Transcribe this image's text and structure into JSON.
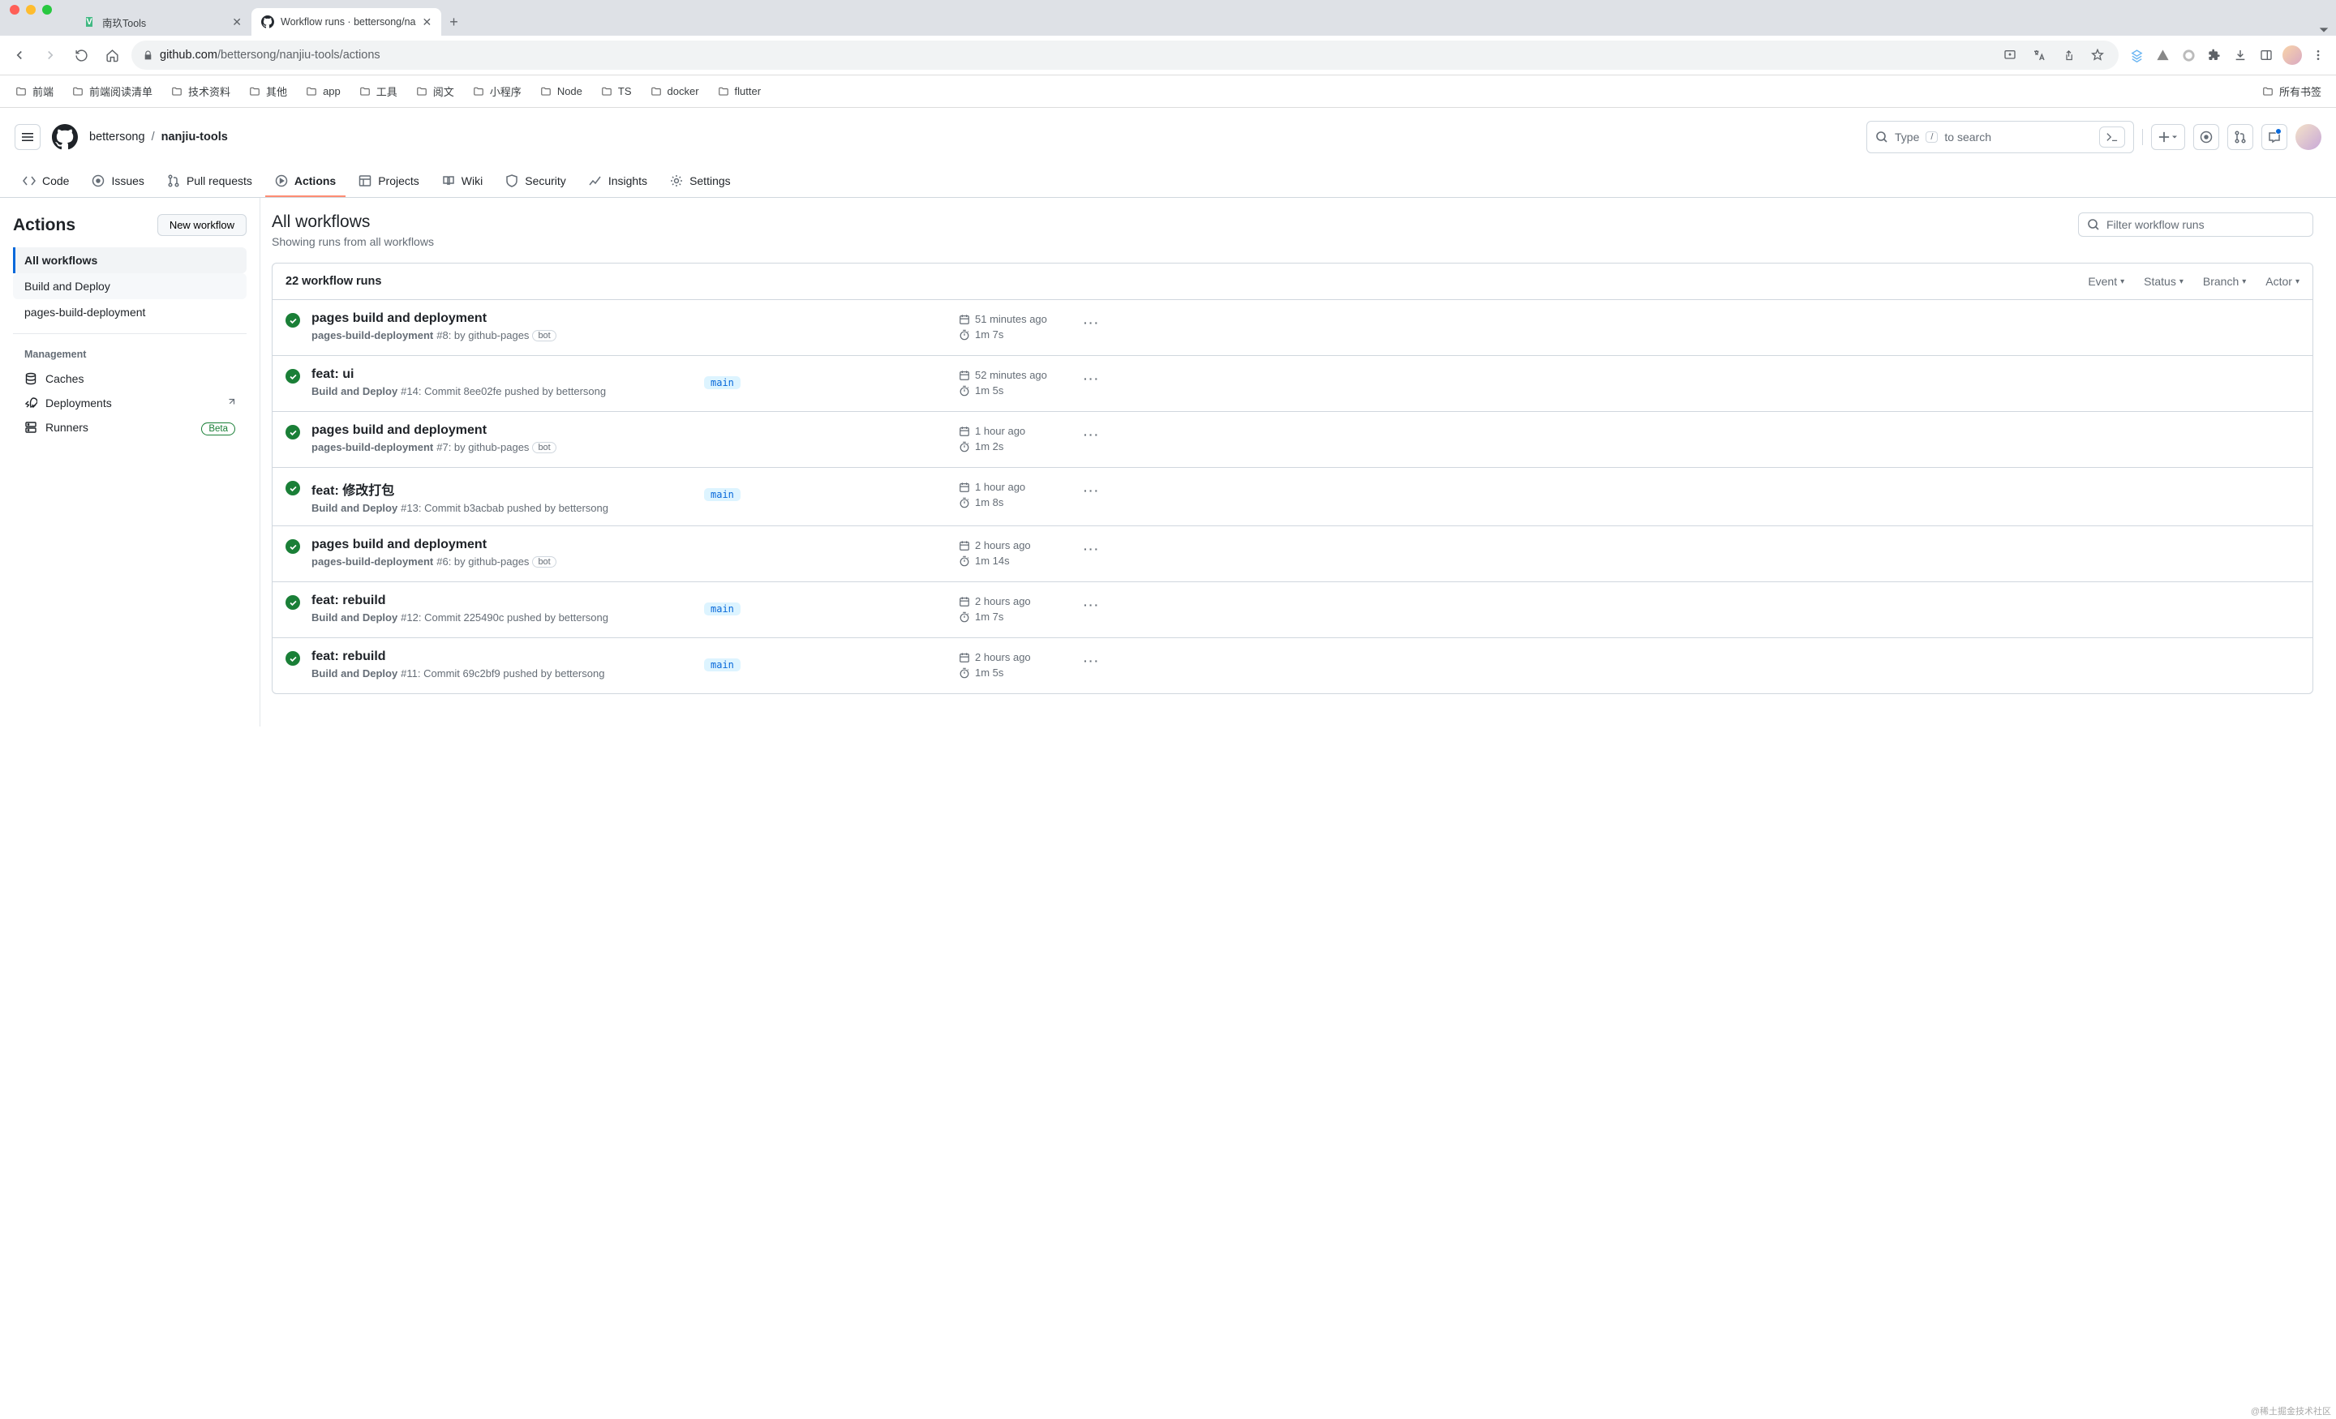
{
  "browser": {
    "tabs": [
      {
        "title": "南玖Tools",
        "favicon_bg": "#41b883",
        "favicon_char": "V",
        "active": false
      },
      {
        "title": "Workflow runs · bettersong/na",
        "favicon_bg": "#24292f",
        "favicon_char": "",
        "active": true
      }
    ],
    "url_host": "github.com",
    "url_path": "/bettersong/nanjiu-tools/actions",
    "bookmarks": [
      "前端",
      "前端阅读清单",
      "技术资料",
      "其他",
      "app",
      "工具",
      "阅文",
      "小程序",
      "Node",
      "TS",
      "docker",
      "flutter"
    ],
    "all_bookmarks": "所有书签"
  },
  "github": {
    "owner": "bettersong",
    "repo": "nanjiu-tools",
    "search_pre": "Type",
    "search_key": "/",
    "search_post": "to search",
    "nav": [
      "Code",
      "Issues",
      "Pull requests",
      "Actions",
      "Projects",
      "Wiki",
      "Security",
      "Insights",
      "Settings"
    ],
    "nav_active": "Actions"
  },
  "sidebar": {
    "title": "Actions",
    "new_workflow": "New workflow",
    "workflows": [
      {
        "label": "All workflows",
        "active": true
      },
      {
        "label": "Build and Deploy",
        "hover": true
      },
      {
        "label": "pages-build-deployment"
      }
    ],
    "mgmt_heading": "Management",
    "mgmt": [
      {
        "label": "Caches",
        "icon": "database"
      },
      {
        "label": "Deployments",
        "icon": "rocket",
        "ext": true
      },
      {
        "label": "Runners",
        "icon": "server",
        "beta": "Beta"
      }
    ]
  },
  "main": {
    "title": "All workflows",
    "subtitle": "Showing runs from all workflows",
    "filter_placeholder": "Filter workflow runs",
    "count_label": "22 workflow runs",
    "filters": [
      "Event",
      "Status",
      "Branch",
      "Actor"
    ],
    "runs": [
      {
        "title": "pages build and deployment",
        "wf": "pages-build-deployment",
        "desc": "#8: by github-pages",
        "bot": "bot",
        "branch": "",
        "time": "51 minutes ago",
        "dur": "1m 7s"
      },
      {
        "title": "feat: ui",
        "wf": "Build and Deploy",
        "desc": "#14: Commit 8ee02fe pushed by bettersong",
        "branch": "main",
        "time": "52 minutes ago",
        "dur": "1m 5s"
      },
      {
        "title": "pages build and deployment",
        "wf": "pages-build-deployment",
        "desc": "#7: by github-pages",
        "bot": "bot",
        "branch": "",
        "time": "1 hour ago",
        "dur": "1m 2s"
      },
      {
        "title": "feat: 修改打包",
        "wf": "Build and Deploy",
        "desc": "#13: Commit b3acbab pushed by bettersong",
        "branch": "main",
        "time": "1 hour ago",
        "dur": "1m 8s"
      },
      {
        "title": "pages build and deployment",
        "wf": "pages-build-deployment",
        "desc": "#6: by github-pages",
        "bot": "bot",
        "branch": "",
        "time": "2 hours ago",
        "dur": "1m 14s"
      },
      {
        "title": "feat: rebuild",
        "wf": "Build and Deploy",
        "desc": "#12: Commit 225490c pushed by bettersong",
        "branch": "main",
        "time": "2 hours ago",
        "dur": "1m 7s"
      },
      {
        "title": "feat: rebuild",
        "wf": "Build and Deploy",
        "desc": "#11: Commit 69c2bf9 pushed by bettersong",
        "branch": "main",
        "time": "2 hours ago",
        "dur": "1m 5s"
      }
    ]
  },
  "watermark": "@稀土掘金技术社区"
}
